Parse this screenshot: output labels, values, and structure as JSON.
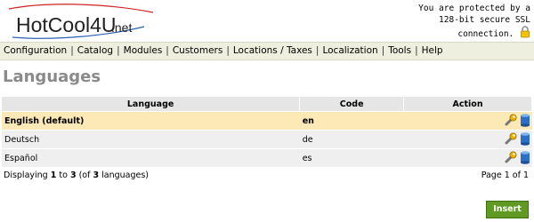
{
  "header": {
    "logo": {
      "text": "HotCool4U",
      "suffix": ".net"
    },
    "ssl": {
      "line1": "You are protected by a",
      "line2": "128-bit secure SSL",
      "line3": "connection."
    }
  },
  "menu": [
    "Configuration",
    "Catalog",
    "Modules",
    "Customers",
    "Locations / Taxes",
    "Localization",
    "Tools",
    "Help"
  ],
  "page": {
    "title": "Languages"
  },
  "table": {
    "headers": {
      "language": "Language",
      "code": "Code",
      "action": "Action"
    },
    "rows": [
      {
        "name": "English (default)",
        "code": "en"
      },
      {
        "name": "Deutsch",
        "code": "de"
      },
      {
        "name": "Español",
        "code": "es"
      }
    ]
  },
  "footer": {
    "pre": "Displaying ",
    "from": "1",
    "mid1": " to ",
    "to": "3",
    "mid2": " (of ",
    "total": "3",
    "post": " languages)",
    "page_info": "Page 1 of 1"
  },
  "buttons": {
    "insert": "Insert"
  },
  "colors": {
    "accent": "#5f9a22",
    "selected_row": "#fde9b6",
    "menubar": "#efefe0",
    "logo_red": "#cc2222",
    "logo_blue": "#2b5fb3"
  },
  "icons": {
    "logo": "logo-swirl-icon",
    "ssl": "padlock-icon",
    "edit": "wrench-icon",
    "delete": "database-icon"
  }
}
